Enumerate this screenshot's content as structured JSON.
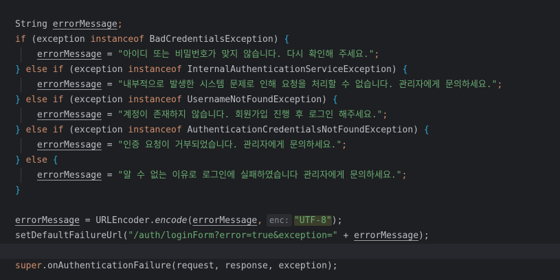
{
  "editor": {
    "l1": {
      "type": "String",
      "var": "errorMessage",
      "semi": ";"
    },
    "l2": {
      "if": "if",
      "open": " (exception ",
      "instanceof": "instanceof",
      "cls": " BadCredentialsException) ",
      "brace": "{"
    },
    "l3": {
      "var": "errorMessage",
      "eq": " = ",
      "str": "\"아이디 또는 비밀번호가 맞지 않습니다. 다시 확인해 주세요.\"",
      "semi": ";"
    },
    "l4": {
      "close": "}",
      "else": " else ",
      "if": "if",
      "open": " (exception ",
      "instanceof": "instanceof",
      "cls": " InternalAuthenticationServiceException) ",
      "brace": "{"
    },
    "l5": {
      "var": "errorMessage",
      "eq": " = ",
      "str": "\"내부적으로 발생한 시스템 문제로 인해 요청을 처리할 수 없습니다. 관리자에게 문의하세요.\"",
      "semi": ";"
    },
    "l6": {
      "close": "}",
      "else": " else ",
      "if": "if",
      "open": " (exception ",
      "instanceof": "instanceof",
      "cls": " UsernameNotFoundException) ",
      "brace": "{"
    },
    "l7": {
      "var": "errorMessage",
      "eq": " = ",
      "str": "\"계정이 존재하지 않습니다. 회원가입 진행 후 로그인 해주세요.\"",
      "semi": ";"
    },
    "l8": {
      "close": "}",
      "else": " else ",
      "if": "if",
      "open": " (exception ",
      "instanceof": "instanceof",
      "cls": " AuthenticationCredentialsNotFoundException) ",
      "brace": "{"
    },
    "l9": {
      "var": "errorMessage",
      "eq": " = ",
      "str": "\"인증 요청이 거부되었습니다. 관리자에게 문의하세요.\"",
      "semi": ";"
    },
    "l10": {
      "close": "}",
      "else": " else ",
      "brace": "{"
    },
    "l11": {
      "var": "errorMessage",
      "eq": " = ",
      "str": "\"알 수 없는 이유로 로그인에 실패하였습니다 관리자에게 문의하세요.\"",
      "semi": ";"
    },
    "l12": {
      "close": "}"
    },
    "l14": {
      "var": "errorMessage",
      "eq": " = URLEncoder.",
      "method": "encode",
      "open": "(",
      "arg": "errorMessage",
      "comma": ",",
      "hint": "enc:",
      "str": "\"UTF-8\"",
      "close": ");"
    },
    "l15": {
      "call": "setDefaultFailureUrl(",
      "str": "\"/auth/loginForm?error=true&exception=\"",
      "plus": " + ",
      "var": "errorMessage",
      "close": ");"
    },
    "l17": {
      "super": "super",
      "call": ".onAuthenticationFailure(request, response, exception);"
    }
  }
}
